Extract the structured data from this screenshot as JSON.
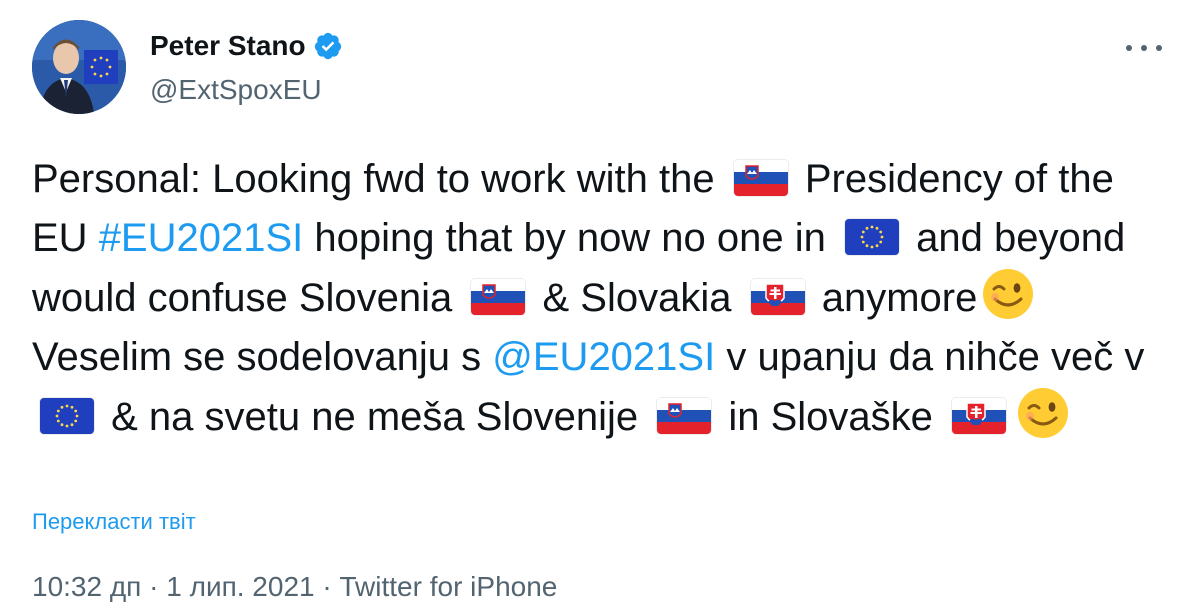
{
  "tweet": {
    "author": {
      "name": "Peter Stano",
      "handle": "@ExtSpoxEU"
    },
    "text": {
      "seg1": "Personal: Looking fwd to work with the ",
      "seg2": " Presidency of the EU ",
      "hashtag1": "#EU2021SI",
      "seg3": " hoping that by now no one in ",
      "seg4": " and beyond would confuse Slovenia ",
      "seg5": " & Slovakia ",
      "seg6": " anymore",
      "seg7": " Veselim se sodelovanju s ",
      "mention1": "@EU2021SI",
      "seg8": " v upanju da nihče več v ",
      "seg9": " & na svetu ne meša Slovenije ",
      "seg10": " in Slovaške "
    },
    "translate_label": "Перекласти твіт",
    "meta": {
      "time": "10:32 дп",
      "sep1": " · ",
      "date": "1 лип. 2021",
      "sep2": " · ",
      "source": "Twitter for iPhone"
    }
  },
  "icons": {
    "verified": "verified-badge-icon",
    "more": "more-options-icon",
    "flag_slovenia": "slovenia-flag-icon",
    "flag_eu": "eu-flag-icon",
    "flag_slovakia": "slovakia-flag-icon",
    "wink": "winking-face-icon"
  },
  "colors": {
    "link": "#1d9bf0",
    "verified": "#1d9bf0",
    "secondary_text": "#536471",
    "primary_text": "#0f1419"
  }
}
